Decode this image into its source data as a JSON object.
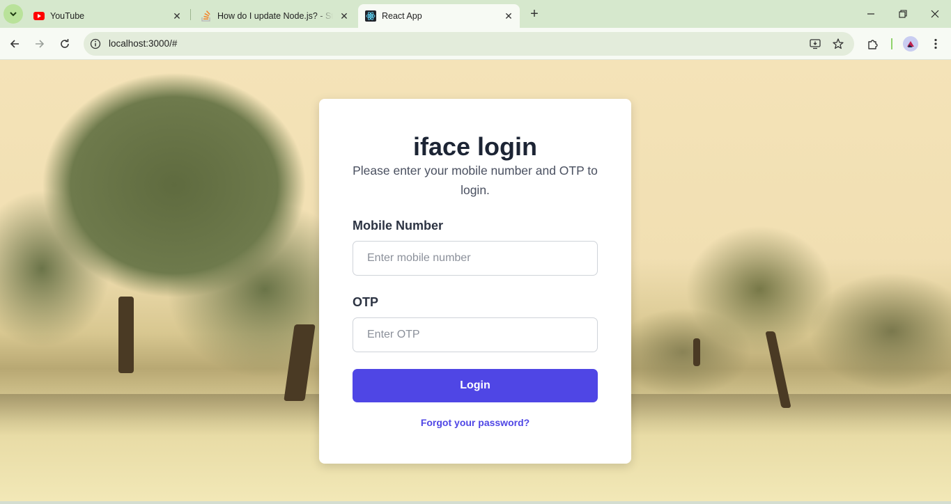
{
  "browser": {
    "tabs": [
      {
        "title": "YouTube",
        "favicon": "youtube-icon"
      },
      {
        "title": "How do I update Node.js? - Stack Overflow",
        "favicon": "stackoverflow-icon"
      },
      {
        "title": "React App",
        "favicon": "react-icon",
        "active": true
      }
    ],
    "url": "localhost:3000/#"
  },
  "login": {
    "title": "iface login",
    "subtitle": "Please enter your mobile number and OTP to login.",
    "mobile_label": "Mobile Number",
    "mobile_placeholder": "Enter mobile number",
    "otp_label": "OTP",
    "otp_placeholder": "Enter OTP",
    "button_label": "Login",
    "forgot_link": "Forgot your password?"
  },
  "colors": {
    "accent": "#4f46e5",
    "title": "#1c2434",
    "tabstrip": "#d6e8cd"
  }
}
